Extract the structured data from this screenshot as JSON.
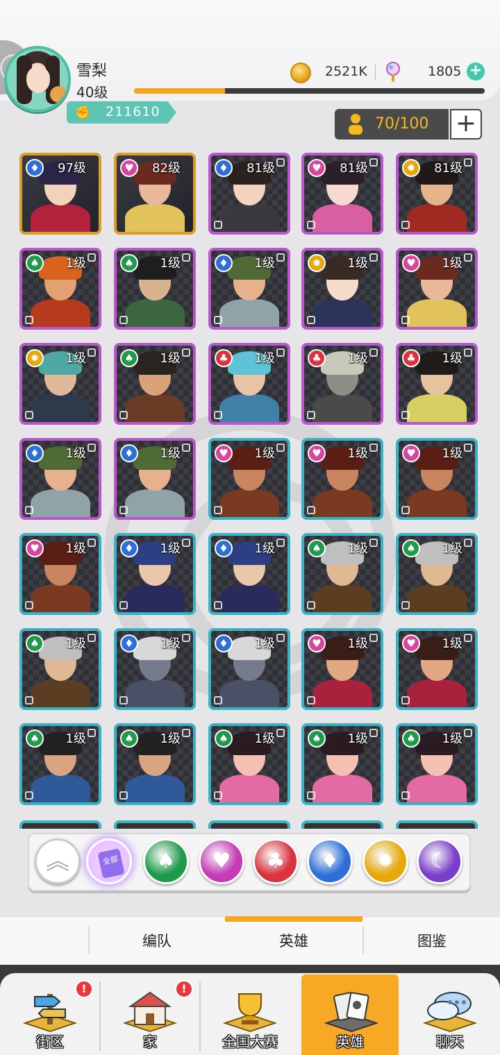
{
  "player": {
    "name": "雪梨",
    "level": "40级",
    "power": "211610",
    "xp_fraction": 0.26
  },
  "resources": {
    "coins": "2521K",
    "gems": "1805"
  },
  "roster": {
    "count": "70/100"
  },
  "heroes": [
    {
      "level": "97级",
      "rarity": "gold",
      "faction": "diamond",
      "skin": "#f1d2bb",
      "hair": "#2c2446",
      "cloth": "#b3213a"
    },
    {
      "level": "82级",
      "rarity": "gold",
      "faction": "heart",
      "skin": "#e8b898",
      "hair": "#6a2a1f",
      "cloth": "#e2c25a"
    },
    {
      "level": "81级",
      "rarity": "purple",
      "faction": "diamond",
      "skin": "#f3d4c0",
      "hair": "#2a221d",
      "cloth": "#3b3940"
    },
    {
      "level": "81级",
      "rarity": "purple",
      "faction": "heart",
      "skin": "#f6d9cf",
      "hair": "#2b1f2a",
      "cloth": "#d95fa3"
    },
    {
      "level": "81级",
      "rarity": "purple",
      "faction": "sun",
      "skin": "#e5b48a",
      "hair": "#1f1a17",
      "cloth": "#9e2a22"
    },
    {
      "level": "1级",
      "rarity": "purple",
      "faction": "spade",
      "skin": "#e3a070",
      "hair": "#d8631e",
      "cloth": "#b53b1c"
    },
    {
      "level": "1级",
      "rarity": "purple",
      "faction": "spade",
      "skin": "#d7b48f",
      "hair": "#1e1e1e",
      "cloth": "#3b6640"
    },
    {
      "level": "1级",
      "rarity": "purple",
      "faction": "diamond",
      "skin": "#e7b18e",
      "hair": "#4f6a34",
      "cloth": "#8fa3a8"
    },
    {
      "level": "1级",
      "rarity": "purple",
      "faction": "sun",
      "skin": "#f6dccb",
      "hair": "#3a2a25",
      "cloth": "#2c3559"
    },
    {
      "level": "1级",
      "rarity": "purple",
      "faction": "heart",
      "skin": "#e8b898",
      "hair": "#6a2a1f",
      "cloth": "#e2c25a"
    },
    {
      "level": "1级",
      "rarity": "purple",
      "faction": "sun",
      "skin": "#e2b89a",
      "hair": "#4fa9a3",
      "cloth": "#2d3a4c"
    },
    {
      "level": "1级",
      "rarity": "purple",
      "faction": "spade",
      "skin": "#d9a27a",
      "hair": "#2a2420",
      "cloth": "#6b3b26"
    },
    {
      "level": "1级",
      "rarity": "purple",
      "faction": "club",
      "skin": "#e8c4a6",
      "hair": "#5ec3d6",
      "cloth": "#3f7fa8"
    },
    {
      "level": "1级",
      "rarity": "purple",
      "faction": "club",
      "skin": "#8c8f86",
      "hair": "#c9c9b9",
      "cloth": "#4a4a4a"
    },
    {
      "level": "1级",
      "rarity": "purple",
      "faction": "club",
      "skin": "#e6c29e",
      "hair": "#1f1b18",
      "cloth": "#d8cf62"
    },
    {
      "level": "1级",
      "rarity": "purple",
      "faction": "diamond",
      "skin": "#e7b18e",
      "hair": "#4f6a34",
      "cloth": "#8fa3a8"
    },
    {
      "level": "1级",
      "rarity": "purple",
      "faction": "diamond",
      "skin": "#e7b18e",
      "hair": "#4f6a34",
      "cloth": "#8fa3a8"
    },
    {
      "level": "1级",
      "rarity": "teal",
      "faction": "heart",
      "skin": "#c98560",
      "hair": "#5a1e14",
      "cloth": "#7a3a22"
    },
    {
      "level": "1级",
      "rarity": "teal",
      "faction": "heart",
      "skin": "#c98560",
      "hair": "#5a1e14",
      "cloth": "#7a3a22"
    },
    {
      "level": "1级",
      "rarity": "teal",
      "faction": "heart",
      "skin": "#c98560",
      "hair": "#5a1e14",
      "cloth": "#7a3a22"
    },
    {
      "level": "1级",
      "rarity": "teal",
      "faction": "heart",
      "skin": "#c98560",
      "hair": "#5a1e14",
      "cloth": "#7a3a22"
    },
    {
      "level": "1级",
      "rarity": "teal",
      "faction": "diamond",
      "skin": "#e9c7aa",
      "hair": "#2d3f82",
      "cloth": "#2a2a5c"
    },
    {
      "level": "1级",
      "rarity": "teal",
      "faction": "diamond",
      "skin": "#e9c7aa",
      "hair": "#2d3f82",
      "cloth": "#2a2a5c"
    },
    {
      "level": "1级",
      "rarity": "teal",
      "faction": "spade",
      "skin": "#e1b894",
      "hair": "#bfbfbf",
      "cloth": "#5b3d22"
    },
    {
      "level": "1级",
      "rarity": "teal",
      "faction": "spade",
      "skin": "#e1b894",
      "hair": "#bfbfbf",
      "cloth": "#5b3d22"
    },
    {
      "level": "1级",
      "rarity": "teal",
      "faction": "spade",
      "skin": "#e1b894",
      "hair": "#bfbfbf",
      "cloth": "#5b3d22"
    },
    {
      "level": "1级",
      "rarity": "teal",
      "faction": "diamond",
      "skin": "#757b8c",
      "hair": "#d8d8d8",
      "cloth": "#4a5066"
    },
    {
      "level": "1级",
      "rarity": "teal",
      "faction": "diamond",
      "skin": "#757b8c",
      "hair": "#d8d8d8",
      "cloth": "#4a5066"
    },
    {
      "level": "1级",
      "rarity": "teal",
      "faction": "heart",
      "skin": "#e2a884",
      "hair": "#3a1d14",
      "cloth": "#a8213d"
    },
    {
      "level": "1级",
      "rarity": "teal",
      "faction": "heart",
      "skin": "#e2a884",
      "hair": "#3a1d14",
      "cloth": "#a8213d"
    },
    {
      "level": "1级",
      "rarity": "teal",
      "faction": "spade",
      "skin": "#d8a580",
      "hair": "#222",
      "cloth": "#2e5a9a"
    },
    {
      "level": "1级",
      "rarity": "teal",
      "faction": "spade",
      "skin": "#d8a580",
      "hair": "#222",
      "cloth": "#2e5a9a"
    },
    {
      "level": "1级",
      "rarity": "teal",
      "faction": "spade",
      "skin": "#f3c0b2",
      "hair": "#2a1a22",
      "cloth": "#e46aa4"
    },
    {
      "level": "1级",
      "rarity": "teal",
      "faction": "spade",
      "skin": "#f3c0b2",
      "hair": "#2a1a22",
      "cloth": "#e46aa4"
    },
    {
      "level": "1级",
      "rarity": "teal",
      "faction": "spade",
      "skin": "#f3c0b2",
      "hair": "#2a1a22",
      "cloth": "#e46aa4"
    }
  ],
  "partial_row_count": 5,
  "filters": [
    {
      "id": "up",
      "icon": "chevrons-up-icon"
    },
    {
      "id": "all",
      "icon": "cards-all-icon",
      "label": "全部",
      "selected": true
    },
    {
      "id": "spade",
      "icon": "spade-icon",
      "color": "#1f9a4a"
    },
    {
      "id": "heart",
      "icon": "heart-icon",
      "color": "#c43bb4"
    },
    {
      "id": "club",
      "icon": "club-icon",
      "color": "#d9343d"
    },
    {
      "id": "diamond",
      "icon": "diamond-icon",
      "color": "#2d6fd6"
    },
    {
      "id": "sun",
      "icon": "sun-icon",
      "color": "#e6a80c"
    },
    {
      "id": "moon",
      "icon": "moon-icon",
      "color": "#7a3fc9"
    }
  ],
  "faction_colors": {
    "spade": "#1f9a4a",
    "heart": "#d9449e",
    "club": "#d9343d",
    "diamond": "#2d6fd6",
    "sun": "#e6a80c",
    "moon": "#7a3fc9"
  },
  "faction_glyphs": {
    "spade": "♠",
    "heart": "♥",
    "club": "♣",
    "diamond": "♦",
    "sun": "✹",
    "moon": "☾"
  },
  "tabs": [
    {
      "label": "编队"
    },
    {
      "label": "英雄",
      "active": true
    },
    {
      "label": "图鉴"
    }
  ],
  "nav": [
    {
      "label": "街区",
      "icon": "signpost-icon",
      "badge": "!"
    },
    {
      "label": "家",
      "icon": "house-icon",
      "badge": "!"
    },
    {
      "label": "全国大赛",
      "icon": "trophy-icon"
    },
    {
      "label": "英雄",
      "icon": "hero-cards-icon",
      "active": true
    },
    {
      "label": "聊天",
      "icon": "chat-bubble-icon"
    }
  ],
  "colors": {
    "accent": "#f5a623",
    "teal": "#5ec4b4",
    "gold_frame": "#d79e2a",
    "purple_frame": "#b957cc",
    "teal_frame": "#3bb1c2"
  }
}
